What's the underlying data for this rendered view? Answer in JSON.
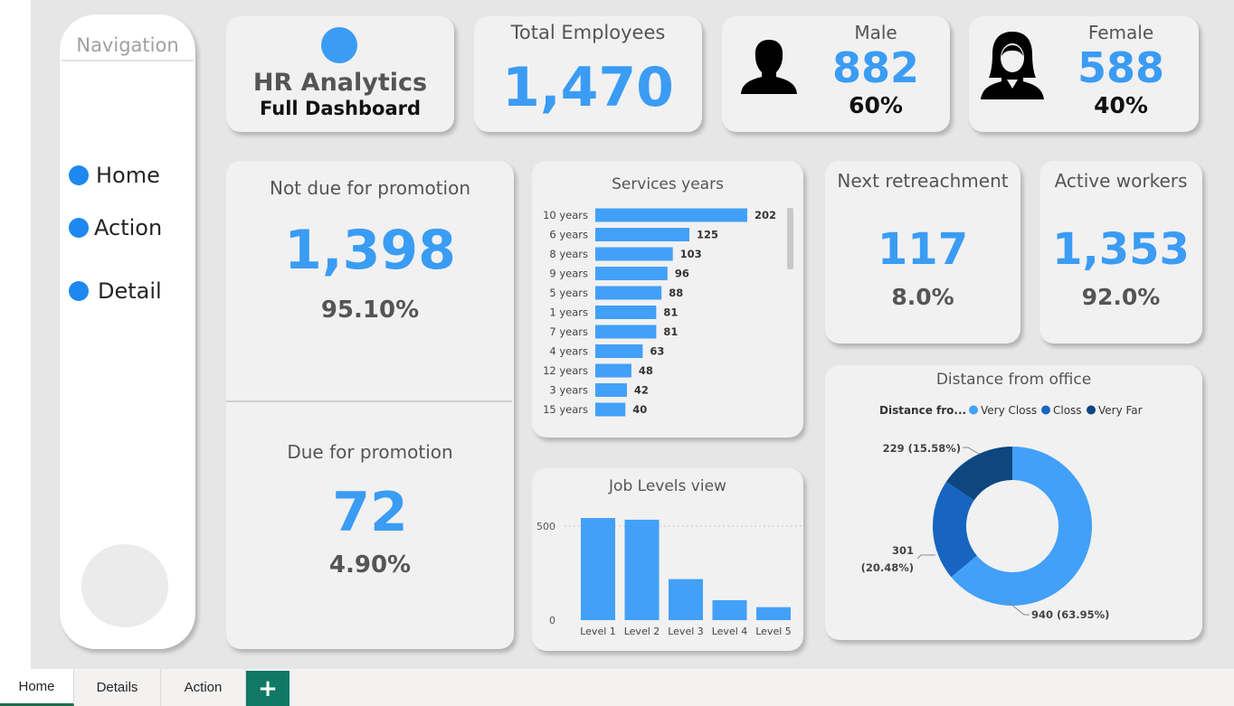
{
  "navigation": {
    "title": "Navigation",
    "items": [
      {
        "label": "Home"
      },
      {
        "label": "Action"
      },
      {
        "label": "Detail"
      }
    ]
  },
  "header": {
    "title": "HR Analytics",
    "subtitle": "Full  Dashboard"
  },
  "kpis": {
    "total_employees": {
      "label": "Total Employees",
      "value": "1,470"
    },
    "male": {
      "label": "Male",
      "value": "882",
      "pct": "60%"
    },
    "female": {
      "label": "Female",
      "value": "588",
      "pct": "40%"
    },
    "not_due": {
      "label": "Not due for promotion",
      "value": "1,398",
      "pct": "95.10%"
    },
    "due": {
      "label": "Due for promotion",
      "value": "72",
      "pct": "4.90%"
    },
    "retrenchment": {
      "label": "Next retreachment",
      "value": "117",
      "pct": "8.0%"
    },
    "active": {
      "label": "Active workers",
      "value": "1,353",
      "pct": "92.0%"
    }
  },
  "colors": {
    "accent": "#3b9cf4",
    "bar": "#42a0f8",
    "very_close": "#42a0f8",
    "close": "#1765c0",
    "very_far": "#0e4680"
  },
  "chart_data": [
    {
      "type": "bar",
      "orientation": "horizontal",
      "title": "Services years",
      "categories": [
        "10 years",
        "6 years",
        "8 years",
        "9 years",
        "5 years",
        "1 years",
        "7 years",
        "4 years",
        "12 years",
        "3 years",
        "15 years"
      ],
      "values": [
        202,
        125,
        103,
        96,
        88,
        81,
        81,
        63,
        48,
        42,
        40
      ],
      "data_labels": [
        "202",
        "125",
        "103",
        "96",
        "88",
        "81",
        "81",
        "63",
        "48",
        "42",
        "40"
      ]
    },
    {
      "type": "bar",
      "title": "Job Levels view",
      "categories": [
        "Level 1",
        "Level 2",
        "Level 3",
        "Level 4",
        "Level 5"
      ],
      "values": [
        543,
        534,
        218,
        106,
        69
      ],
      "yticks": [
        "500",
        "0"
      ],
      "ylim": [
        0,
        560
      ],
      "grid": true
    },
    {
      "type": "pie",
      "donut": true,
      "title": "Distance from office",
      "legend_title": "Distance fro...",
      "legend_position": "top",
      "categories": [
        "Very Closs",
        "Closs",
        "Very Far"
      ],
      "values": [
        940,
        301,
        229
      ],
      "percents": [
        63.95,
        20.48,
        15.58
      ],
      "data_labels": [
        "940 (63.95%)",
        "301 (20.48%)",
        "229 (15.58%)"
      ]
    }
  ],
  "bottom_tabs": {
    "home": "Home",
    "details": "Details",
    "action": "Action",
    "add": "+"
  }
}
